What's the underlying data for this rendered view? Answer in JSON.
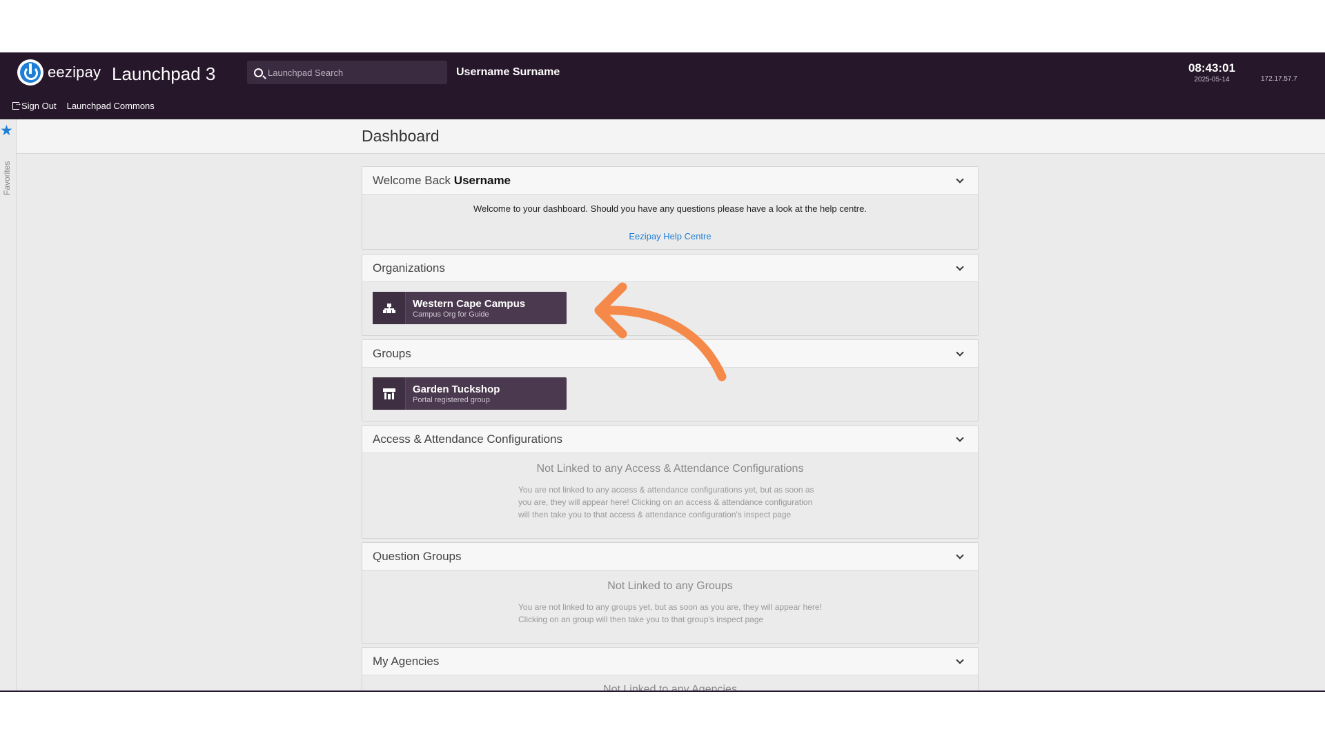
{
  "header": {
    "logo_text": "eezipay",
    "app_title": "Launchpad 3",
    "search_placeholder": "Launchpad Search",
    "username": "Username Surname",
    "time": "08:43:01",
    "date": "2025-05-14",
    "ip": "172.17.57.7",
    "nav": [
      {
        "label": "Sign Out",
        "icon": "sign-out-icon"
      },
      {
        "label": "Launchpad Commons"
      }
    ]
  },
  "favorites": {
    "label": "Favorites",
    "icon": "star-icon"
  },
  "page_title": "Dashboard",
  "panels": {
    "welcome": {
      "title_prefix": "Welcome Back",
      "title_name": "Username",
      "text": "Welcome to your dashboard. Should you have any questions please have a look at the help centre.",
      "link": "Eezipay Help Centre"
    },
    "organizations": {
      "title": "Organizations",
      "tile": {
        "name": "Western Cape Campus",
        "sub": "Campus Org for Guide",
        "icon": "org-chart-icon"
      }
    },
    "groups": {
      "title": "Groups",
      "tile": {
        "name": "Garden Tuckshop",
        "sub": "Portal registered group",
        "icon": "shop-icon"
      }
    },
    "access": {
      "title": "Access & Attendance Configurations",
      "empty_title": "Not Linked to any Access & Attendance Configurations",
      "empty_text": "You are not linked to any access & attendance configurations yet, but as soon as you are, they will appear here! Clicking on an access & attendance configuration will then take you to that access & attendance configuration's inspect page"
    },
    "question_groups": {
      "title": "Question Groups",
      "empty_title": "Not Linked to any Groups",
      "empty_text": "You are not linked to any groups yet, but as soon as you are, they will appear here! Clicking on an group will then take you to that group's inspect page"
    },
    "agencies": {
      "title": "My Agencies",
      "empty_title": "Not Linked to any Agencies"
    }
  },
  "annotation": {
    "color": "#f5894a"
  }
}
